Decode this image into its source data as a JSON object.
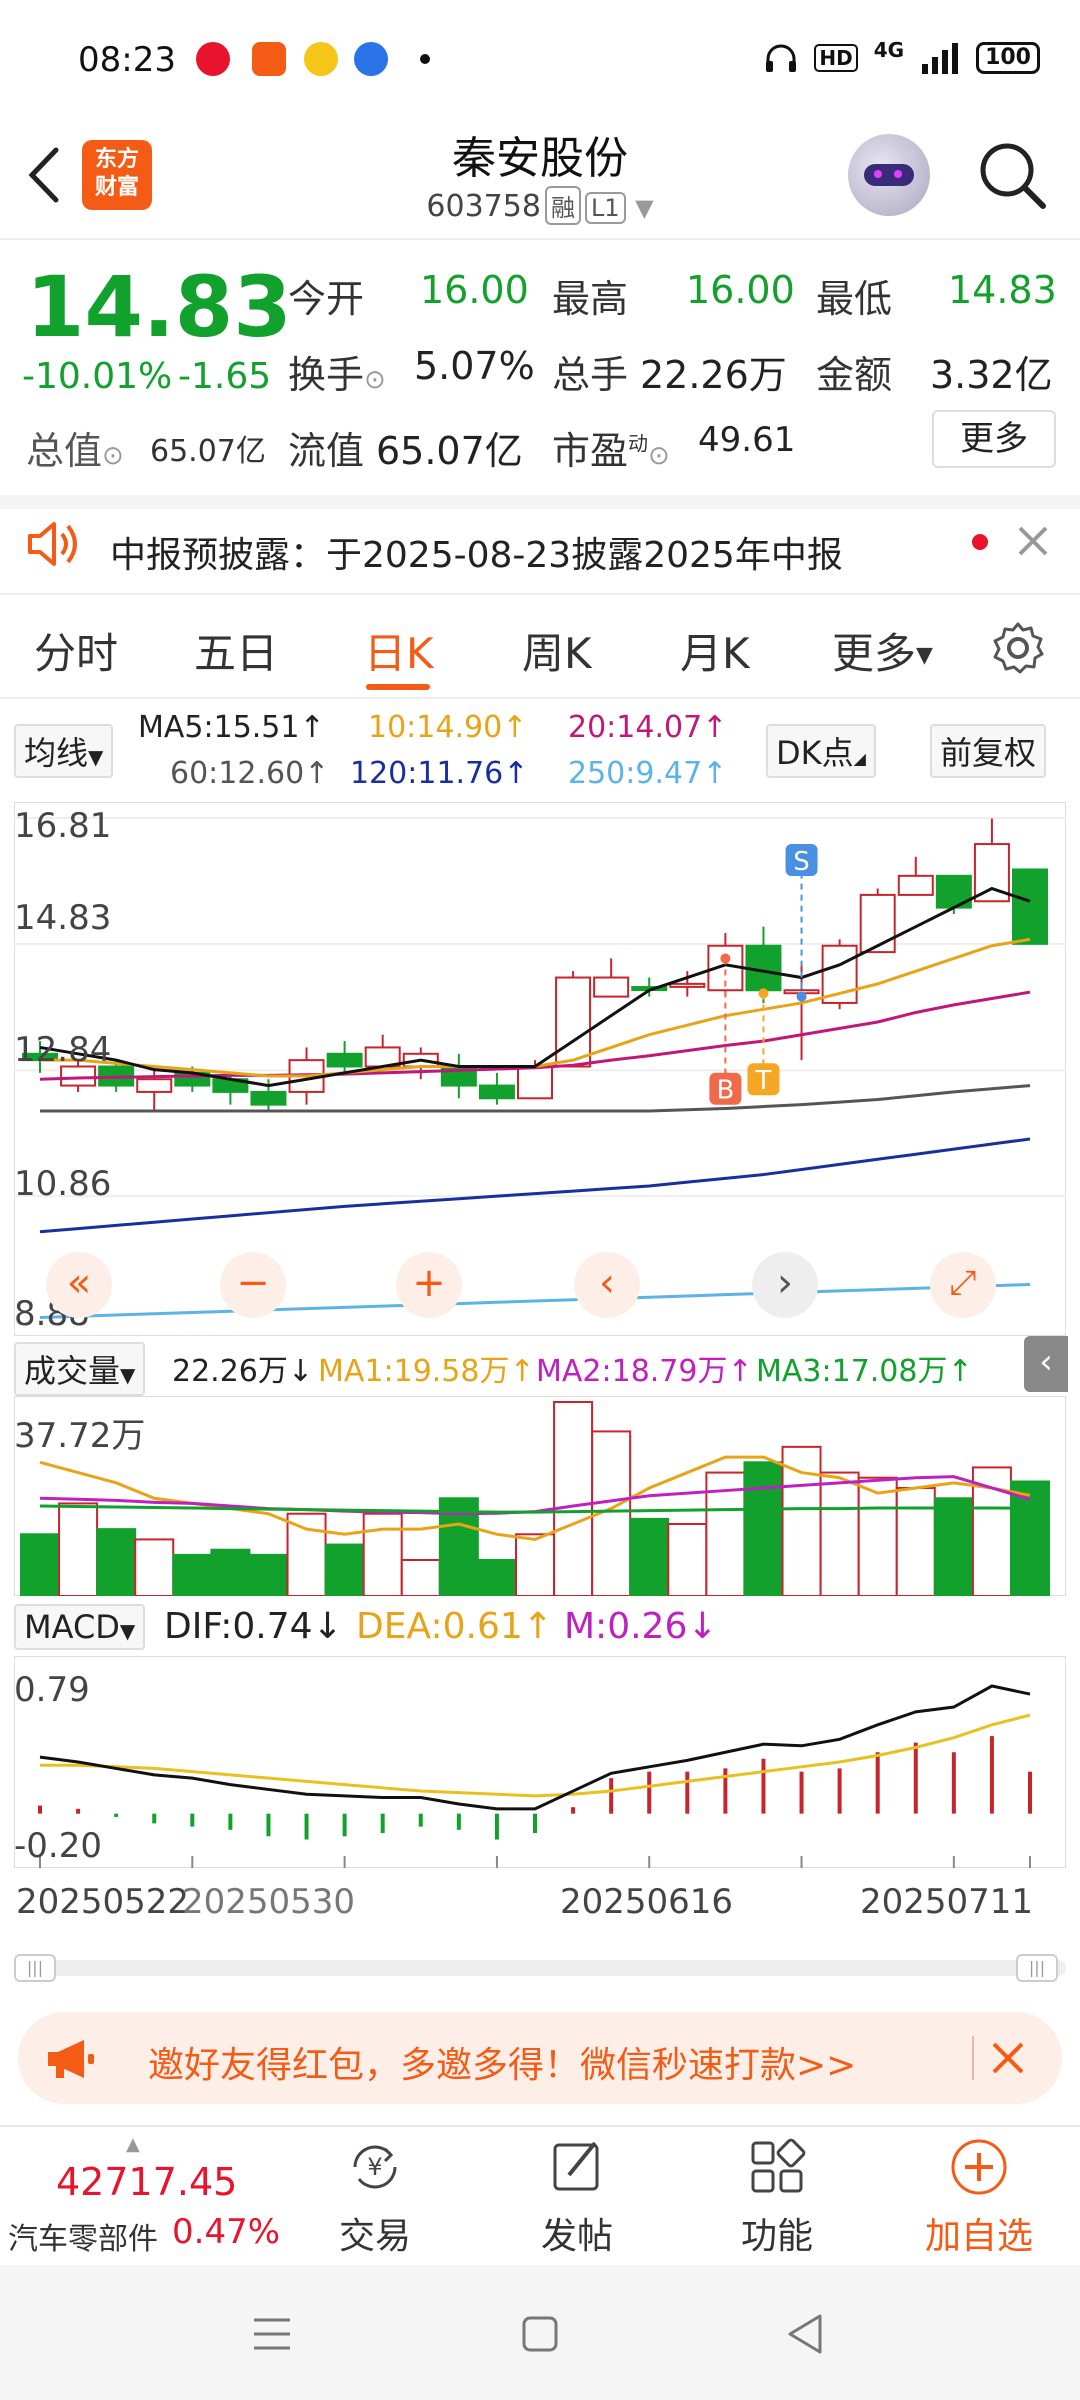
{
  "status_bar": {
    "time": "08:23",
    "battery": "100",
    "network": "4G",
    "hd": "HD"
  },
  "header": {
    "title": "秦安股份",
    "code": "603758",
    "tag1": "融",
    "tag2": "L1"
  },
  "logo": {
    "line1": "东方",
    "line2": "财富"
  },
  "quote": {
    "price": "14.83",
    "change_pct": "-10.01%",
    "change": "-1.65",
    "open_label": "今开",
    "open": "16.00",
    "high_label": "最高",
    "high": "16.00",
    "low_label": "最低",
    "low": "14.83",
    "turnover_label": "换手",
    "turnover": "5.07%",
    "volume_label": "总手",
    "volume": "22.26万",
    "amount_label": "金额",
    "amount": "3.32亿",
    "total_cap_label": "总值",
    "total_cap": "65.07亿",
    "float_cap_label": "流值",
    "float_cap": "65.07亿",
    "pe_label": "市盈",
    "pe_sup": "动",
    "pe": "49.61",
    "more_label": "更多"
  },
  "notice": {
    "text": "中报预披露：于2025-08-23披露2025年中报"
  },
  "tabs": [
    {
      "label": "分时"
    },
    {
      "label": "五日"
    },
    {
      "label": "日K"
    },
    {
      "label": "周K"
    },
    {
      "label": "月K"
    },
    {
      "label": "更多"
    }
  ],
  "ma_bar": {
    "selector": "均线",
    "ma5": "MA5:15.51",
    "ma10": "10:14.90",
    "ma20": "20:14.07",
    "ma60": "60:12.60",
    "ma120": "120:11.76",
    "ma250": "250:9.47",
    "dk_label": "DK点",
    "fq_label": "前复权"
  },
  "kline_axis": {
    "y1": "16.81",
    "y2": "14.83",
    "y3": "12.84",
    "y4": "10.86",
    "y5": "8.88"
  },
  "signals": {
    "s": "S",
    "b": "B",
    "t": "T"
  },
  "volume_bar": {
    "selector": "成交量",
    "vol": "22.26万",
    "ma1": "MA1:19.58万",
    "ma2": "MA2:18.79万",
    "ma3": "MA3:17.08万",
    "axis_top": "37.72万"
  },
  "macd_bar": {
    "selector": "MACD",
    "dif": "DIF:0.74",
    "dea": "DEA:0.61",
    "m": "M:0.26",
    "axis_top": "0.79",
    "axis_bottom": "-0.20"
  },
  "x_dates": [
    "20250522",
    "20250530",
    "20250616",
    "20250711"
  ],
  "promo": {
    "text": "邀好友得红包，多邀多得！微信秒速打款>>"
  },
  "bottom_nav": {
    "index_value": "42717.45",
    "index_name": "汽车零部件",
    "index_change": "0.47%",
    "items": [
      {
        "label": "交易"
      },
      {
        "label": "发帖"
      },
      {
        "label": "功能"
      },
      {
        "label": "加自选"
      }
    ]
  },
  "chart_data": {
    "type": "candlestick",
    "candles": [
      {
        "o": 13.1,
        "c": 13.0,
        "h": 13.3,
        "l": 12.8,
        "up": false
      },
      {
        "o": 12.6,
        "c": 12.9,
        "h": 13.0,
        "l": 12.5,
        "up": true
      },
      {
        "o": 12.9,
        "c": 12.6,
        "h": 13.0,
        "l": 12.5,
        "up": false
      },
      {
        "o": 12.5,
        "c": 12.7,
        "h": 12.9,
        "l": 12.2,
        "up": true
      },
      {
        "o": 12.8,
        "c": 12.6,
        "h": 12.9,
        "l": 12.5,
        "up": false
      },
      {
        "o": 12.7,
        "c": 12.5,
        "h": 12.8,
        "l": 12.3,
        "up": false
      },
      {
        "o": 12.5,
        "c": 12.3,
        "h": 12.7,
        "l": 12.2,
        "up": false
      },
      {
        "o": 12.5,
        "c": 13.0,
        "h": 13.2,
        "l": 12.3,
        "up": true
      },
      {
        "o": 13.1,
        "c": 12.9,
        "h": 13.3,
        "l": 12.8,
        "up": false
      },
      {
        "o": 12.9,
        "c": 13.2,
        "h": 13.4,
        "l": 12.9,
        "up": true
      },
      {
        "o": 12.9,
        "c": 13.1,
        "h": 13.2,
        "l": 12.7,
        "up": true
      },
      {
        "o": 12.9,
        "c": 12.6,
        "h": 13.1,
        "l": 12.4,
        "up": false
      },
      {
        "o": 12.6,
        "c": 12.4,
        "h": 12.8,
        "l": 12.3,
        "up": false
      },
      {
        "o": 12.4,
        "c": 12.9,
        "h": 13.0,
        "l": 12.4,
        "up": true
      },
      {
        "o": 12.9,
        "c": 14.3,
        "h": 14.4,
        "l": 12.9,
        "up": true
      },
      {
        "o": 14.0,
        "c": 14.3,
        "h": 14.6,
        "l": 14.0,
        "up": true
      },
      {
        "o": 14.15,
        "c": 14.15,
        "h": 14.3,
        "l": 14.0,
        "up": false
      },
      {
        "o": 14.2,
        "c": 14.2,
        "h": 14.4,
        "l": 14.0,
        "up": true
      },
      {
        "o": 14.1,
        "c": 14.8,
        "h": 15.0,
        "l": 14.0,
        "up": true
      },
      {
        "o": 14.8,
        "c": 14.1,
        "h": 15.1,
        "l": 13.9,
        "up": false
      },
      {
        "o": 14.1,
        "c": 14.1,
        "h": 14.5,
        "l": 13.0,
        "up": true
      },
      {
        "o": 13.9,
        "c": 14.8,
        "h": 14.9,
        "l": 13.8,
        "up": true
      },
      {
        "o": 14.7,
        "c": 15.6,
        "h": 15.7,
        "l": 14.7,
        "up": true
      },
      {
        "o": 15.6,
        "c": 15.9,
        "h": 16.2,
        "l": 15.6,
        "up": true
      },
      {
        "o": 15.9,
        "c": 15.4,
        "h": 15.9,
        "l": 15.3,
        "up": false
      },
      {
        "o": 15.5,
        "c": 16.4,
        "h": 16.8,
        "l": 15.5,
        "up": true
      },
      {
        "o": 16.0,
        "c": 14.83,
        "h": 16.0,
        "l": 14.83,
        "up": false
      }
    ],
    "ylim": [
      8.88,
      16.81
    ],
    "ma5": [
      13.2,
      13.1,
      13.0,
      12.85,
      12.8,
      12.7,
      12.6,
      12.7,
      12.8,
      12.9,
      13.0,
      12.9,
      12.9,
      12.9,
      13.3,
      13.7,
      14.1,
      14.3,
      14.5,
      14.4,
      14.3,
      14.5,
      14.8,
      15.1,
      15.4,
      15.7,
      15.5
    ],
    "ma10": [
      13.0,
      13.0,
      12.95,
      12.9,
      12.85,
      12.8,
      12.75,
      12.75,
      12.8,
      12.85,
      12.9,
      12.9,
      12.9,
      12.9,
      13.0,
      13.2,
      13.4,
      13.55,
      13.7,
      13.8,
      13.9,
      14.05,
      14.2,
      14.4,
      14.6,
      14.8,
      14.9
    ],
    "ma20": [
      12.7,
      12.72,
      12.73,
      12.74,
      12.75,
      12.76,
      12.76,
      12.77,
      12.78,
      12.8,
      12.82,
      12.84,
      12.86,
      12.88,
      12.92,
      13.0,
      13.07,
      13.15,
      13.23,
      13.3,
      13.4,
      13.5,
      13.6,
      13.75,
      13.87,
      13.97,
      14.07
    ],
    "ma60": [
      12.2,
      12.2,
      12.2,
      12.2,
      12.2,
      12.2,
      12.2,
      12.2,
      12.2,
      12.2,
      12.2,
      12.2,
      12.2,
      12.2,
      12.2,
      12.2,
      12.2,
      12.22,
      12.24,
      12.27,
      12.3,
      12.34,
      12.38,
      12.44,
      12.5,
      12.55,
      12.6
    ],
    "ma120": [
      10.3,
      10.35,
      10.4,
      10.45,
      10.5,
      10.55,
      10.6,
      10.65,
      10.7,
      10.74,
      10.78,
      10.82,
      10.86,
      10.9,
      10.94,
      10.98,
      11.02,
      11.08,
      11.14,
      11.2,
      11.28,
      11.36,
      11.44,
      11.52,
      11.6,
      11.68,
      11.76
    ],
    "ma250": [
      8.95,
      8.97,
      8.99,
      9.01,
      9.03,
      9.05,
      9.07,
      9.09,
      9.11,
      9.13,
      9.15,
      9.17,
      9.19,
      9.21,
      9.23,
      9.25,
      9.27,
      9.29,
      9.31,
      9.33,
      9.35,
      9.37,
      9.39,
      9.41,
      9.43,
      9.45,
      9.47
    ],
    "volume": [
      12,
      18,
      13,
      11,
      8,
      9,
      8,
      16,
      10,
      16,
      7,
      19,
      7,
      12,
      37.72,
      32,
      15,
      14,
      24,
      26,
      29,
      24,
      23,
      21,
      19,
      25,
      22.26
    ],
    "vol_ma1": [
      26,
      24,
      22,
      19,
      18,
      17,
      16,
      13,
      12,
      13,
      13,
      14,
      12,
      11,
      14,
      17,
      21,
      24,
      27,
      27,
      24,
      23,
      20,
      21,
      22,
      21,
      19.58
    ],
    "vol_ma2": [
      19,
      18.8,
      18.6,
      18.2,
      18,
      17.5,
      17,
      16.8,
      16.5,
      16.3,
      16.2,
      16,
      16.1,
      16.4,
      17.5,
      18.5,
      19.5,
      20,
      20.5,
      21,
      21.5,
      22,
      22.5,
      23,
      23.2,
      21,
      18.79
    ],
    "vol_ma3": [
      17.5,
      17.4,
      17.3,
      17.2,
      17.1,
      17,
      16.9,
      16.8,
      16.7,
      16.6,
      16.5,
      16.4,
      16.3,
      16.3,
      16.4,
      16.5,
      16.6,
      16.7,
      16.8,
      16.9,
      17.0,
      17.0,
      17.1,
      17.1,
      17.1,
      17.1,
      17.08
    ],
    "dif": [
      0.35,
      0.32,
      0.28,
      0.24,
      0.22,
      0.18,
      0.15,
      0.12,
      0.11,
      0.1,
      0.1,
      0.06,
      0.03,
      0.03,
      0.14,
      0.25,
      0.29,
      0.33,
      0.38,
      0.43,
      0.42,
      0.46,
      0.55,
      0.63,
      0.66,
      0.79,
      0.74
    ],
    "dea": [
      0.3,
      0.3,
      0.29,
      0.28,
      0.26,
      0.24,
      0.22,
      0.2,
      0.18,
      0.16,
      0.14,
      0.13,
      0.12,
      0.11,
      0.12,
      0.14,
      0.17,
      0.2,
      0.23,
      0.26,
      0.29,
      0.32,
      0.36,
      0.41,
      0.47,
      0.55,
      0.61
    ],
    "macd": [
      0.05,
      0.03,
      -0.02,
      -0.06,
      -0.08,
      -0.1,
      -0.14,
      -0.16,
      -0.14,
      -0.12,
      -0.08,
      -0.1,
      -0.16,
      -0.12,
      0.04,
      0.22,
      0.26,
      0.26,
      0.28,
      0.34,
      0.26,
      0.28,
      0.38,
      0.44,
      0.38,
      0.48,
      0.26
    ]
  }
}
